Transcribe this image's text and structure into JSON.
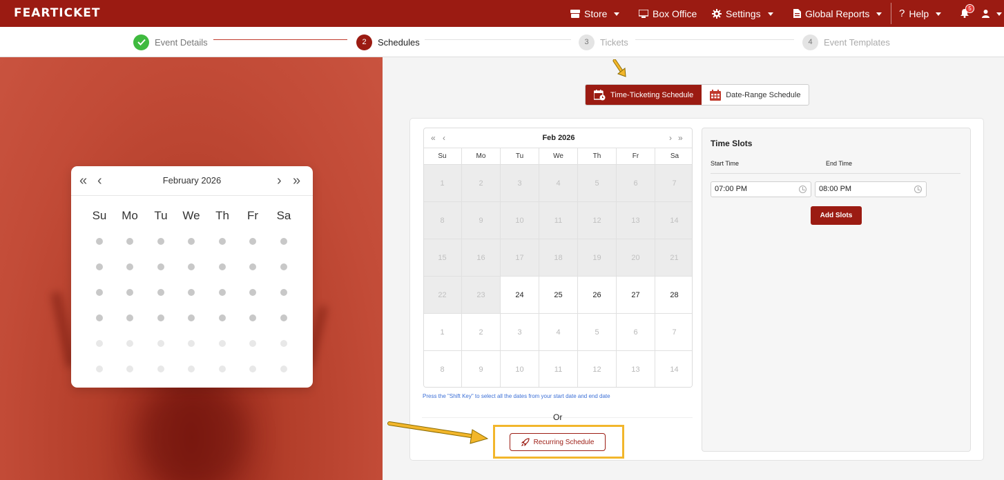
{
  "app": {
    "logo": "FEARTICKET"
  },
  "nav": {
    "store": "Store",
    "box_office": "Box Office",
    "settings": "Settings",
    "global_reports": "Global Reports",
    "help": "Help",
    "notification_count": "5"
  },
  "stepper": {
    "steps": [
      {
        "number": "✓",
        "label": "Event Details",
        "state": "done"
      },
      {
        "number": "2",
        "label": "Schedules",
        "state": "active"
      },
      {
        "number": "3",
        "label": "Tickets",
        "state": "pending"
      },
      {
        "number": "4",
        "label": "Event Templates",
        "state": "pending"
      }
    ]
  },
  "hero_calendar": {
    "month": "February 2026",
    "weekdays": [
      "Su",
      "Mo",
      "Tu",
      "We",
      "Th",
      "Fr",
      "Sa"
    ]
  },
  "schedule_type": {
    "time_ticketing": "Time-Ticketing Schedule",
    "date_range": "Date-Range Schedule"
  },
  "calendar": {
    "title": "Feb  2026",
    "weekdays": [
      "Su",
      "Mo",
      "Tu",
      "We",
      "Th",
      "Fr",
      "Sa"
    ],
    "weeks": [
      [
        {
          "d": "1",
          "s": "disabled"
        },
        {
          "d": "2",
          "s": "disabled"
        },
        {
          "d": "3",
          "s": "disabled"
        },
        {
          "d": "4",
          "s": "disabled"
        },
        {
          "d": "5",
          "s": "disabled"
        },
        {
          "d": "6",
          "s": "disabled"
        },
        {
          "d": "7",
          "s": "disabled"
        }
      ],
      [
        {
          "d": "8",
          "s": "disabled"
        },
        {
          "d": "9",
          "s": "disabled"
        },
        {
          "d": "10",
          "s": "disabled"
        },
        {
          "d": "11",
          "s": "disabled"
        },
        {
          "d": "12",
          "s": "disabled"
        },
        {
          "d": "13",
          "s": "disabled"
        },
        {
          "d": "14",
          "s": "disabled"
        }
      ],
      [
        {
          "d": "15",
          "s": "disabled"
        },
        {
          "d": "16",
          "s": "disabled"
        },
        {
          "d": "17",
          "s": "disabled"
        },
        {
          "d": "18",
          "s": "disabled"
        },
        {
          "d": "19",
          "s": "disabled"
        },
        {
          "d": "20",
          "s": "disabled"
        },
        {
          "d": "21",
          "s": "disabled"
        }
      ],
      [
        {
          "d": "22",
          "s": "disabled"
        },
        {
          "d": "23",
          "s": "disabled"
        },
        {
          "d": "24",
          "s": "avail"
        },
        {
          "d": "25",
          "s": "avail"
        },
        {
          "d": "26",
          "s": "avail"
        },
        {
          "d": "27",
          "s": "avail"
        },
        {
          "d": "28",
          "s": "avail"
        }
      ],
      [
        {
          "d": "1",
          "s": "next"
        },
        {
          "d": "2",
          "s": "next"
        },
        {
          "d": "3",
          "s": "next"
        },
        {
          "d": "4",
          "s": "next"
        },
        {
          "d": "5",
          "s": "next"
        },
        {
          "d": "6",
          "s": "next"
        },
        {
          "d": "7",
          "s": "next"
        }
      ],
      [
        {
          "d": "8",
          "s": "next"
        },
        {
          "d": "9",
          "s": "next"
        },
        {
          "d": "10",
          "s": "next"
        },
        {
          "d": "11",
          "s": "next"
        },
        {
          "d": "12",
          "s": "next"
        },
        {
          "d": "13",
          "s": "next"
        },
        {
          "d": "14",
          "s": "next"
        }
      ]
    ],
    "hint": "Press the \"Shift Key\" to select all the dates from your start date and end date",
    "or_label": "Or",
    "recurring_button": "Recurring Schedule"
  },
  "time_slots": {
    "title": "Time Slots",
    "start_label": "Start Time",
    "end_label": "End Time",
    "start_value": "07:00 PM",
    "end_value": "08:00 PM",
    "add_button": "Add Slots"
  },
  "colors": {
    "brand": "#9b1b12",
    "success": "#3fba3f",
    "highlight": "#f2b62b",
    "link": "#3b6fd6"
  }
}
